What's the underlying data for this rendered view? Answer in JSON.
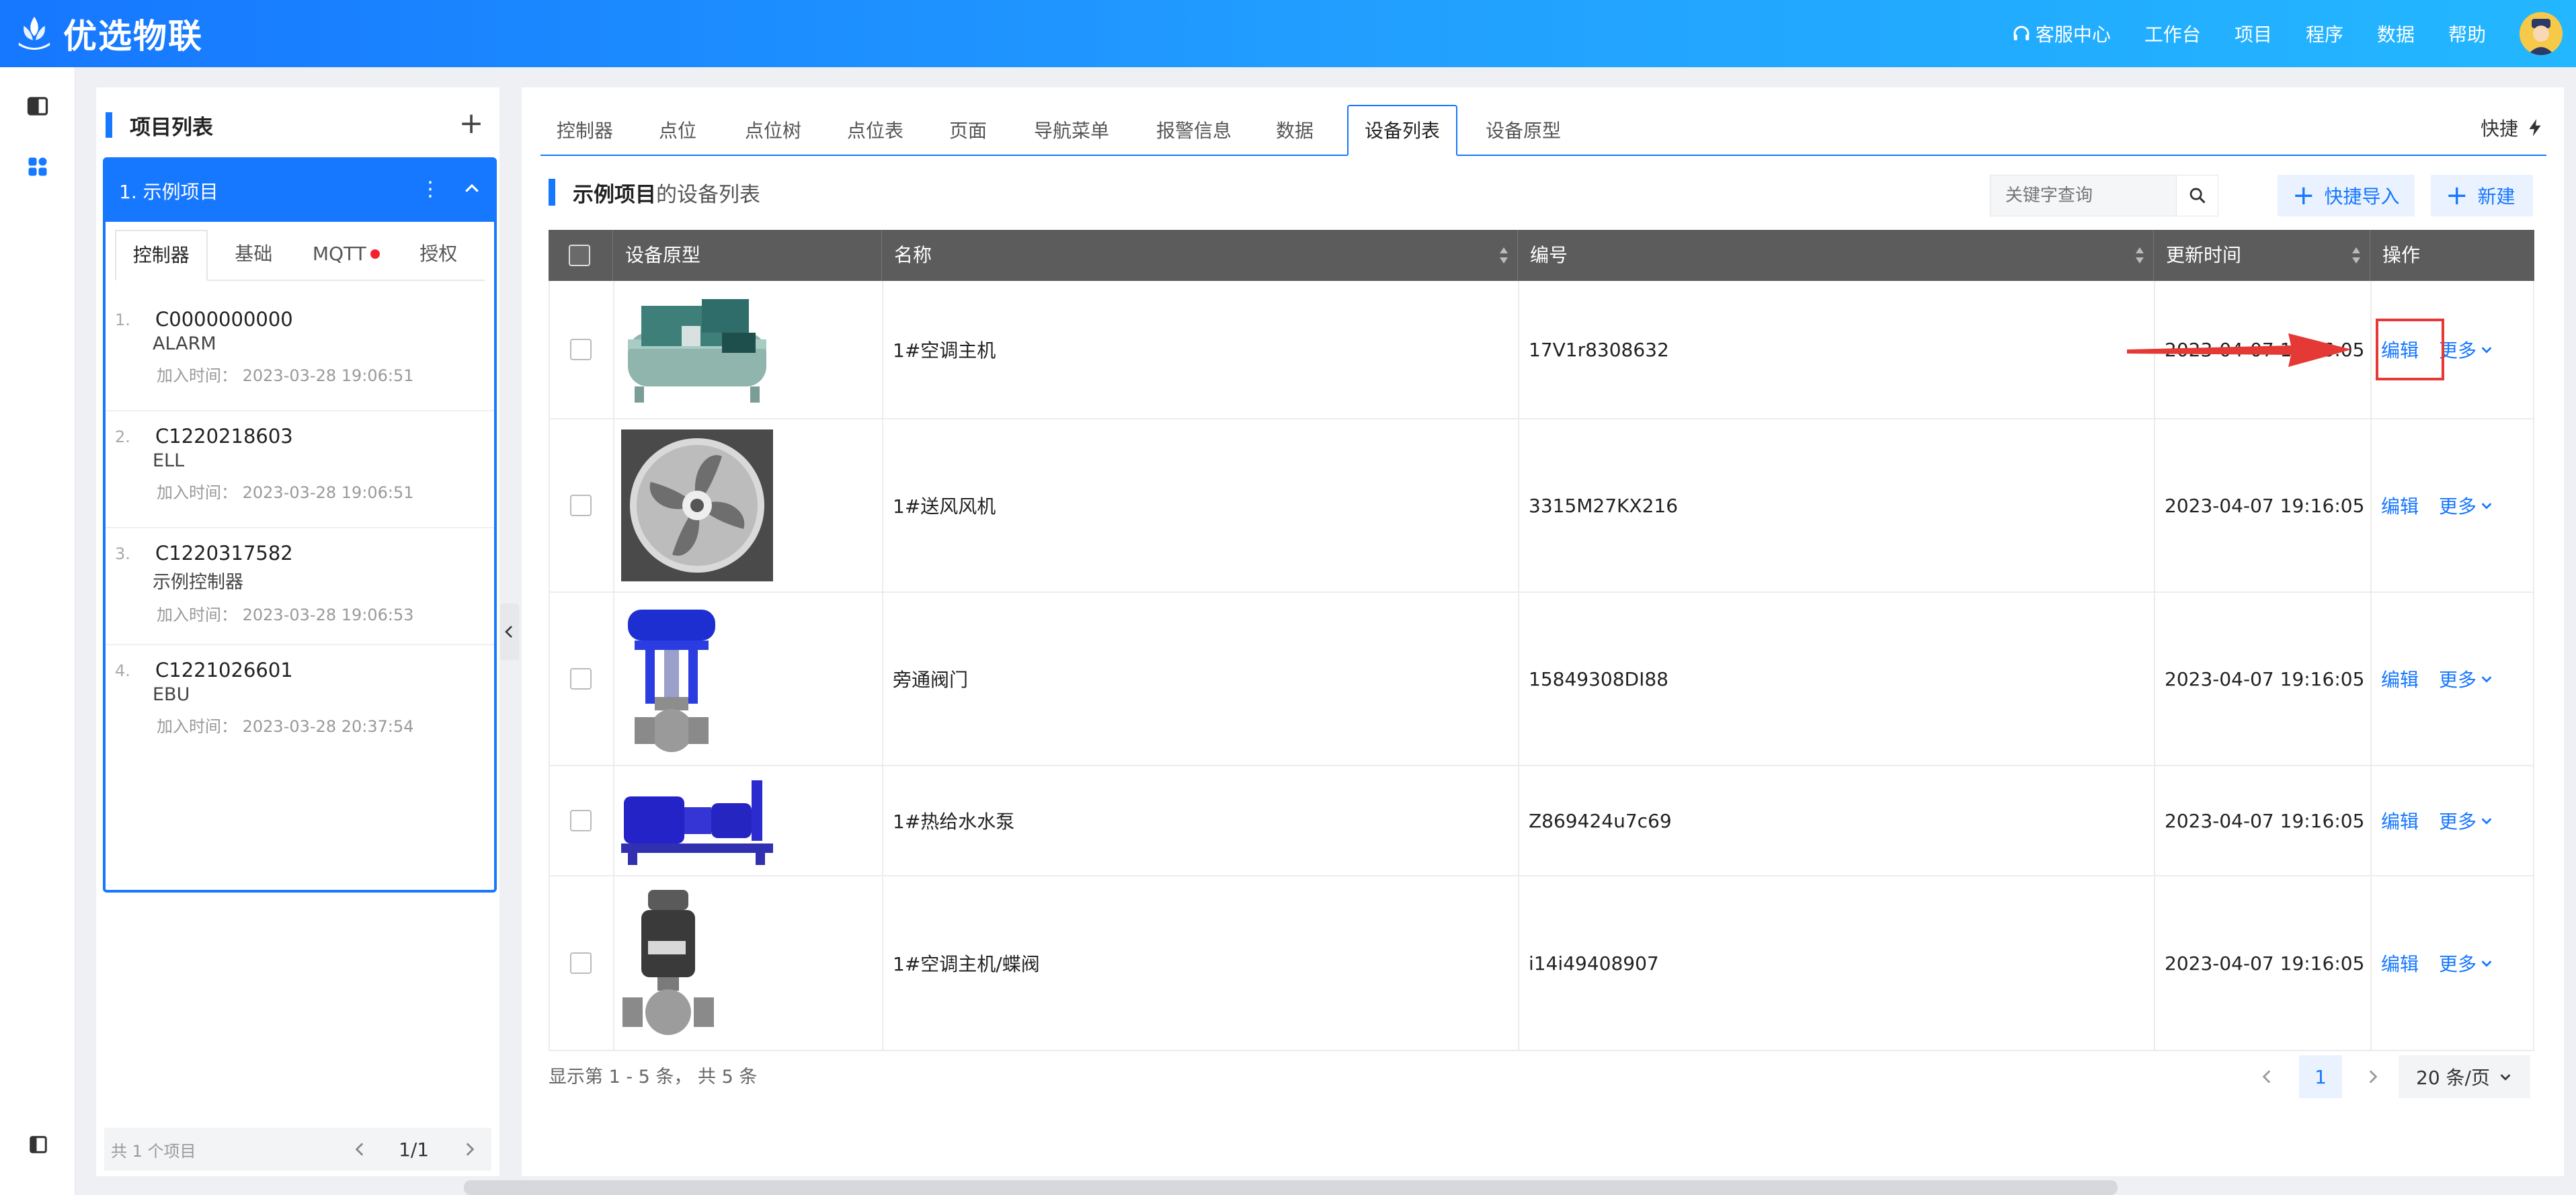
{
  "app": {
    "title": "优选物联"
  },
  "topnav": {
    "service": "客服中心",
    "workbench": "工作台",
    "project": "项目",
    "program": "程序",
    "data": "数据",
    "help": "帮助"
  },
  "project_panel": {
    "title": "项目列表",
    "project": "1. 示例项目",
    "subtabs": [
      "控制器",
      "基础",
      "MQTT",
      "授权"
    ],
    "controllers": [
      {
        "idx": "1.",
        "code": "C0000000000",
        "name": "ALARM",
        "time": "加入时间： 2023-03-28 19:06:51"
      },
      {
        "idx": "2.",
        "code": "C1220218603",
        "name": "ELL",
        "time": "加入时间： 2023-03-28 19:06:51"
      },
      {
        "idx": "3.",
        "code": "C1220317582",
        "name": "示例控制器",
        "time": "加入时间： 2023-03-28 19:06:53"
      },
      {
        "idx": "4.",
        "code": "C1221026601",
        "name": "EBU",
        "time": "加入时间： 2023-03-28 20:37:54"
      }
    ],
    "footer_count": "共 1 个项目",
    "footer_pages": "1/1"
  },
  "tabs": [
    "控制器",
    "点位",
    "点位树",
    "点位表",
    "页面",
    "导航菜单",
    "报警信息",
    "数据",
    "设备列表",
    "设备原型"
  ],
  "quick": "快捷",
  "section": {
    "project": "示例项目",
    "suffix": "的设备列表"
  },
  "search": {
    "placeholder": "关键字查询"
  },
  "buttons": {
    "quick_import": "快捷导入",
    "new": "新建"
  },
  "table": {
    "headers": [
      "设备原型",
      "名称",
      "编号",
      "更新时间",
      "操作"
    ],
    "rows": [
      {
        "name": "1#空调主机",
        "code": "17V1r8308632",
        "time": "2023-04-07 19:16:05",
        "image": "chiller-icon"
      },
      {
        "name": "1#送风风机",
        "code": "3315M27KX216",
        "time": "2023-04-07 19:16:05",
        "image": "fan-icon"
      },
      {
        "name": "旁通阀门",
        "code": "15849308DI88",
        "time": "2023-04-07 19:16:05",
        "image": "valve-icon"
      },
      {
        "name": "1#热给水水泵",
        "code": "Z869424u7c69",
        "time": "2023-04-07 19:16:05",
        "image": "pump-icon"
      },
      {
        "name": "1#空调主机/蝶阀",
        "code": "i14i49408907",
        "time": "2023-04-07 19:16:05",
        "image": "butterfly-valve-icon"
      }
    ],
    "edit": "编辑",
    "more": "更多"
  },
  "pagination": {
    "info": "显示第 1 - 5 条， 共 5 条",
    "current": "1",
    "page_size": "20 条/页"
  },
  "colors": {
    "primary": "#1677ff",
    "header": "#5c5c5c",
    "annotation": "#e53935"
  }
}
